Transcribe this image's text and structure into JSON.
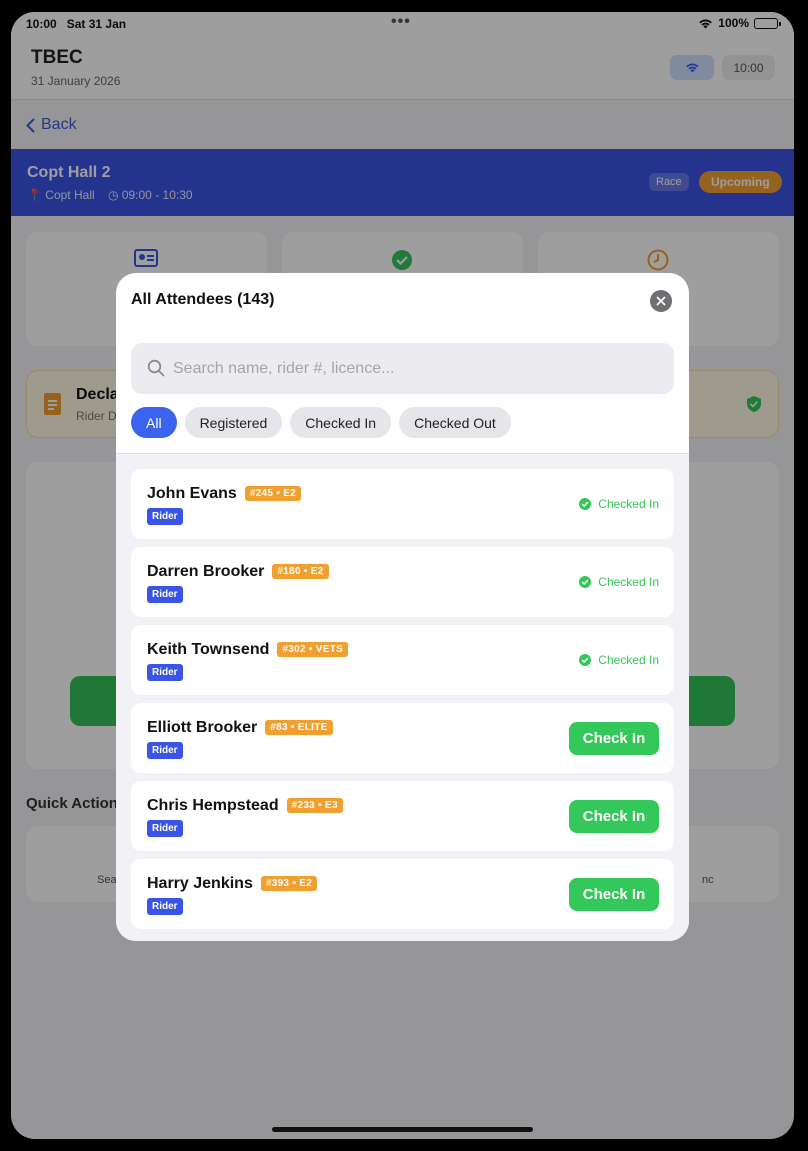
{
  "status_bar": {
    "time": "10:00",
    "date": "Sat 31 Jan",
    "battery": "100%"
  },
  "header": {
    "title": "TBEC",
    "date": "31 January 2026",
    "clock": "10:00"
  },
  "nav": {
    "back_label": "Back"
  },
  "session": {
    "name": "Copt Hall 2",
    "location": "Copt Hall",
    "time_range": "09:00 - 10:30",
    "type_badge": "Race",
    "status_badge": "Upcoming"
  },
  "background": {
    "declaration_title": "Decla",
    "declaration_sub": "Rider D",
    "quick_actions": "Quick Action",
    "qa_left": "Sea",
    "qa_right": "nc"
  },
  "modal": {
    "title": "All Attendees (143)",
    "search_placeholder": "Search name, rider #, licence...",
    "filters": [
      "All",
      "Registered",
      "Checked In",
      "Checked Out"
    ],
    "active_filter": "All",
    "attendees": [
      {
        "name": "John Evans",
        "number": "#245 • E2",
        "role": "Rider",
        "status": "Checked In"
      },
      {
        "name": "Darren Brooker",
        "number": "#180 • E2",
        "role": "Rider",
        "status": "Checked In"
      },
      {
        "name": "Keith Townsend",
        "number": "#302 • VETS",
        "role": "Rider",
        "status": "Checked In"
      },
      {
        "name": "Elliott Brooker",
        "number": "#83 • ELITE",
        "role": "Rider",
        "action": "Check In"
      },
      {
        "name": "Chris Hempstead",
        "number": "#233 • E3",
        "role": "Rider",
        "action": "Check In"
      },
      {
        "name": "Harry Jenkins",
        "number": "#393 • E2",
        "role": "Rider",
        "action": "Check In"
      }
    ]
  },
  "colors": {
    "accent": "#3a63f0",
    "session_bar": "#3a55e6",
    "success": "#34c759",
    "badge_orange": "#f0a030"
  }
}
